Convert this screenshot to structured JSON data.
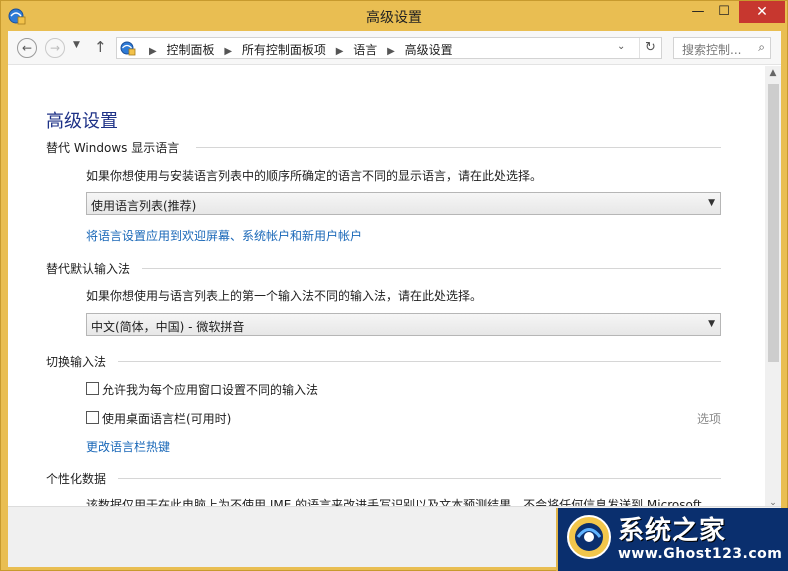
{
  "window": {
    "title": "高级设置",
    "min_glyph": "—",
    "max_glyph": "☐",
    "close_glyph": "✕"
  },
  "nav": {
    "breadcrumbs": [
      "控制面板",
      "所有控制面板项",
      "语言",
      "高级设置"
    ],
    "search_placeholder": "搜索控制..."
  },
  "page": {
    "title": "高级设置",
    "sections": {
      "display_language": {
        "heading": "替代 Windows 显示语言",
        "description": "如果你想使用与安装语言列表中的顺序所确定的语言不同的显示语言，请在此处选择。",
        "selected": "使用语言列表(推荐)",
        "link": "将语言设置应用到欢迎屏幕、系统帐户和新用户帐户"
      },
      "default_input": {
        "heading": "替代默认输入法",
        "description": "如果你想使用与语言列表上的第一个输入法不同的输入法，请在此处选择。",
        "selected": "中文(简体，中国) - 微软拼音"
      },
      "switch_input": {
        "heading": "切换输入法",
        "checkbox1": "允许我为每个应用窗口设置不同的输入法",
        "checkbox2": "使用桌面语言栏(可用时)",
        "options_label": "选项",
        "hotkey_link": "更改语言栏热键"
      },
      "personalization": {
        "heading": "个性化数据",
        "description": "该数据仅用于在此电脑上为不使用 IME 的语言来改进手写识别以及文本预测结果。不会将任何信息发送到 Microsoft。"
      }
    }
  },
  "watermark": {
    "main": "系统之家",
    "sub": "www.Ghost123.com"
  },
  "colors": {
    "frame": "#e9be52",
    "close": "#c7372f",
    "title_blue": "#1e3287",
    "link": "#1a68b8"
  }
}
